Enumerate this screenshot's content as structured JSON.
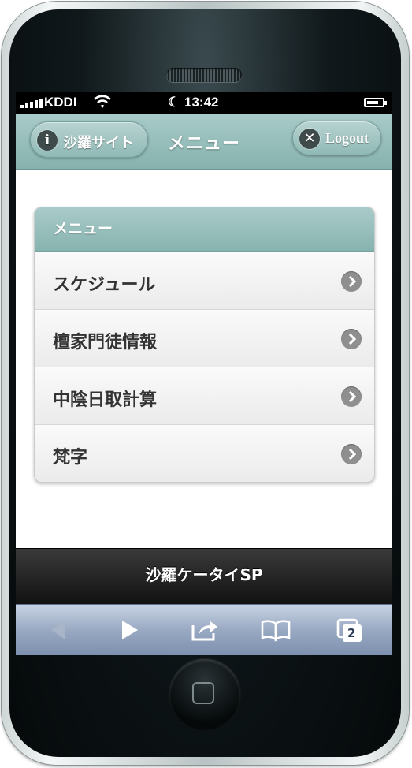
{
  "statusbar": {
    "carrier": "KDDI",
    "time": "13:42"
  },
  "header": {
    "title": "メニュー",
    "left_button": "沙羅サイト",
    "right_button": "Logout"
  },
  "menu": {
    "heading": "メニュー",
    "items": [
      {
        "label": "スケジュール"
      },
      {
        "label": "檀家門徒情報"
      },
      {
        "label": "中陰日取計算"
      },
      {
        "label": "梵字"
      }
    ]
  },
  "footer": {
    "text": "沙羅ケータイSP"
  },
  "toolbar": {
    "tabs_count": "2"
  },
  "colors": {
    "header": "#93bbb7",
    "footer": "#1e1e1e",
    "toolbar": "#9aa9c1"
  }
}
